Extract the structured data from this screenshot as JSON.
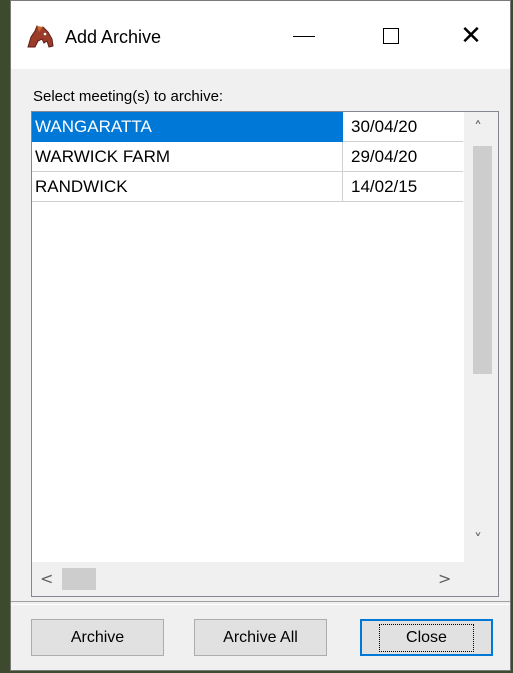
{
  "window": {
    "title": "Add Archive",
    "icon": "horse-head-icon"
  },
  "titlebar_buttons": {
    "minimize": "—",
    "maximize": "☐",
    "close": "✕"
  },
  "prompt": "Select meeting(s) to archive:",
  "meetings": [
    {
      "name": "WANGARATTA",
      "date": "30/04/20",
      "selected": true
    },
    {
      "name": "WARWICK FARM",
      "date": "29/04/20",
      "selected": false
    },
    {
      "name": "RANDWICK",
      "date": "14/02/15",
      "selected": false
    }
  ],
  "scroll_arrows": {
    "up": "˄",
    "down": "˅",
    "left": "<",
    "right": ">"
  },
  "buttons": {
    "archive": "Archive",
    "archive_all": "Archive All",
    "close": "Close"
  },
  "colors": {
    "selection": "#0078d7"
  }
}
